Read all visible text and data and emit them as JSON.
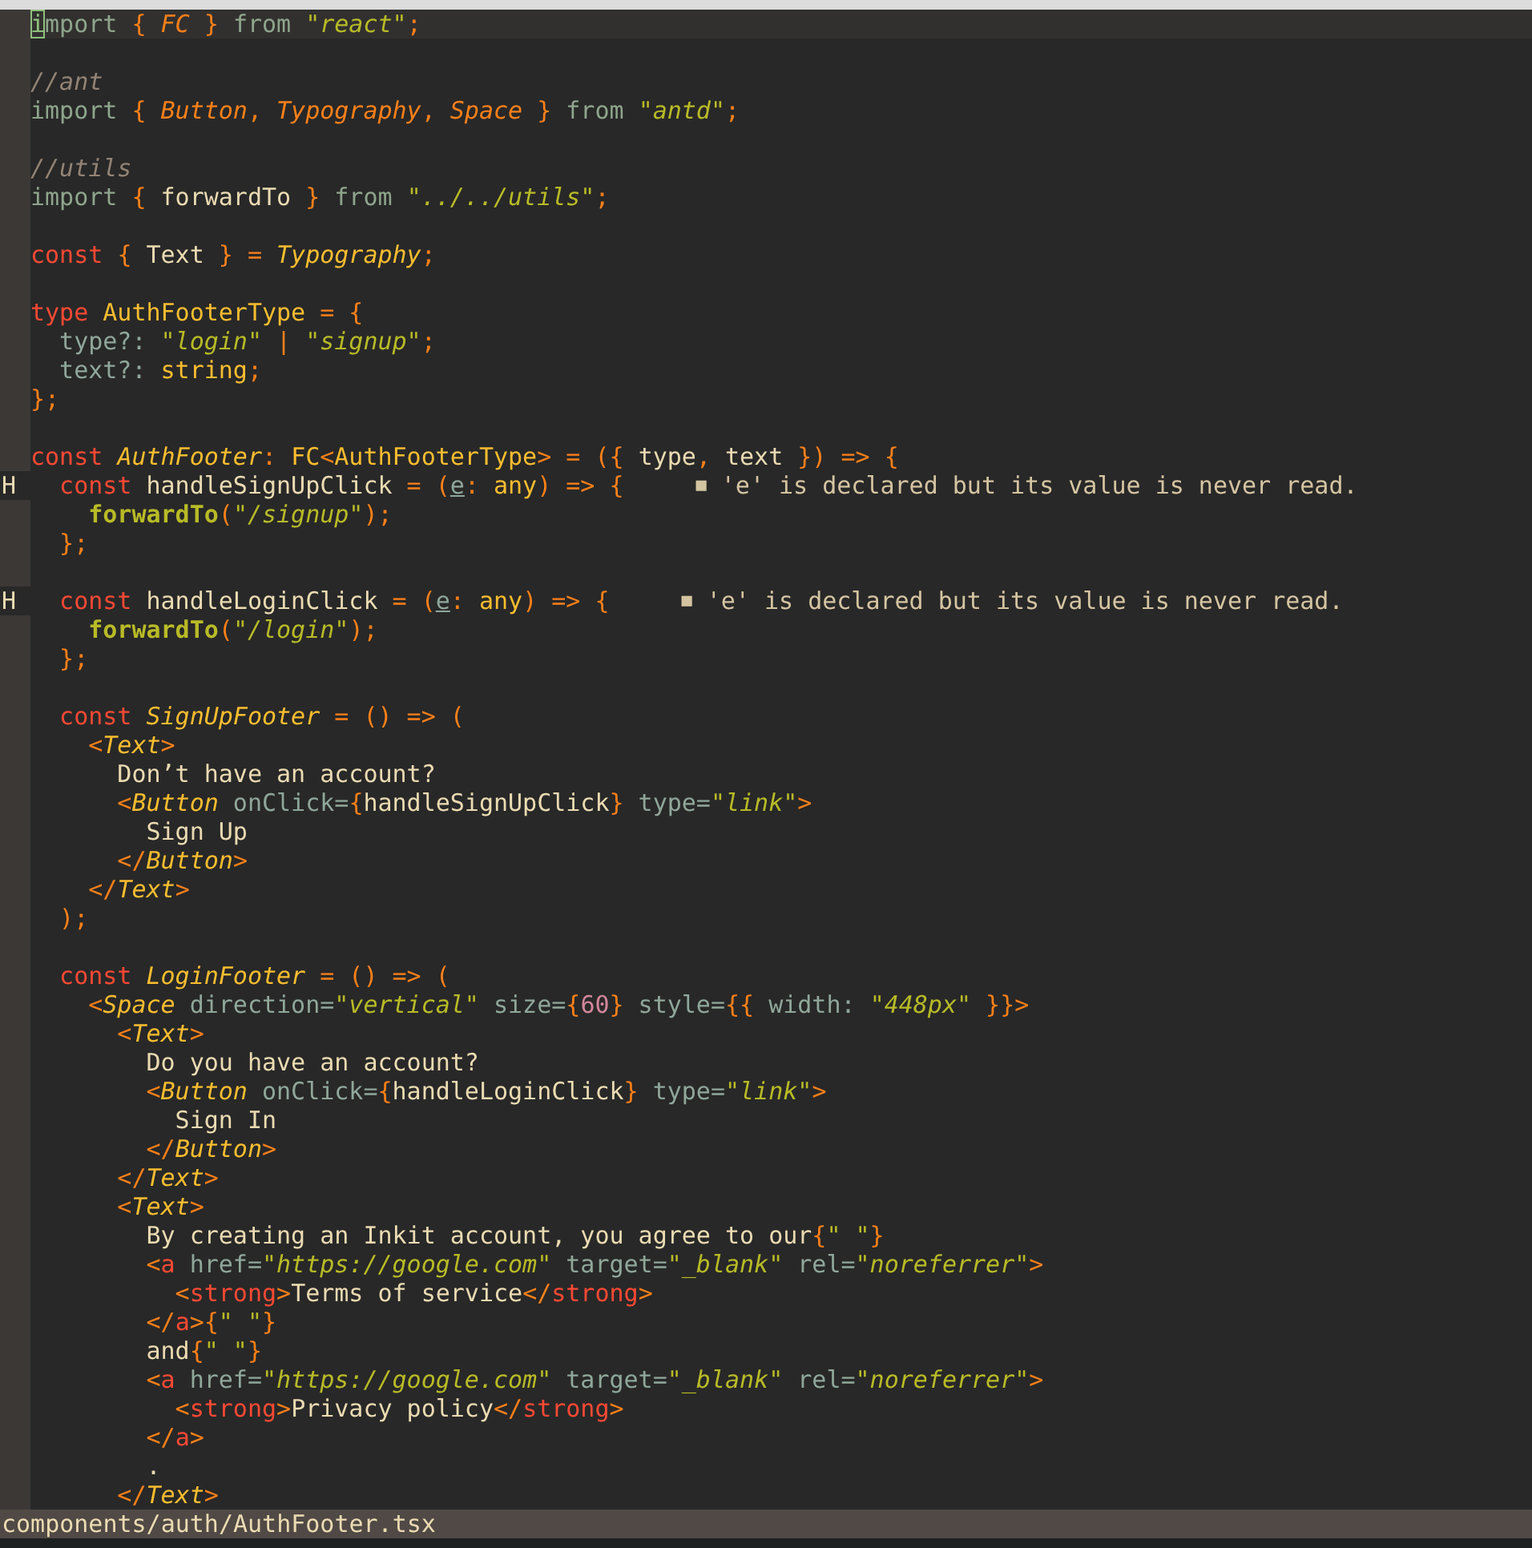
{
  "editor": {
    "lines": [
      {
        "kind": "code",
        "current": true,
        "tokens": [
          {
            "kind": "cur",
            "text": "i"
          },
          {
            "kind": "im",
            "text": "mport "
          },
          {
            "kind": "p",
            "text": "{ "
          },
          {
            "kind": "ti",
            "text": "FC"
          },
          {
            "kind": "p",
            "text": " } "
          },
          {
            "kind": "im",
            "text": "from "
          },
          {
            "kind": "s",
            "text": "\"react\""
          },
          {
            "kind": "p",
            "text": ";"
          }
        ]
      },
      {
        "kind": "blank"
      },
      {
        "kind": "code",
        "tokens": [
          {
            "kind": "c",
            "text": "//ant"
          }
        ]
      },
      {
        "kind": "code",
        "tokens": [
          {
            "kind": "im",
            "text": "import "
          },
          {
            "kind": "p",
            "text": "{ "
          },
          {
            "kind": "ti",
            "text": "Button"
          },
          {
            "kind": "p",
            "text": ", "
          },
          {
            "kind": "ti",
            "text": "Typography"
          },
          {
            "kind": "p",
            "text": ", "
          },
          {
            "kind": "ti",
            "text": "Space"
          },
          {
            "kind": "p",
            "text": " } "
          },
          {
            "kind": "im",
            "text": "from "
          },
          {
            "kind": "s",
            "text": "\"antd\""
          },
          {
            "kind": "p",
            "text": ";"
          }
        ]
      },
      {
        "kind": "blank"
      },
      {
        "kind": "code",
        "tokens": [
          {
            "kind": "c",
            "text": "//utils"
          }
        ]
      },
      {
        "kind": "code",
        "tokens": [
          {
            "kind": "im",
            "text": "import "
          },
          {
            "kind": "p",
            "text": "{ "
          },
          {
            "kind": "id",
            "text": "forwardTo"
          },
          {
            "kind": "p",
            "text": " } "
          },
          {
            "kind": "im",
            "text": "from "
          },
          {
            "kind": "s",
            "text": "\"../../utils\""
          },
          {
            "kind": "p",
            "text": ";"
          }
        ]
      },
      {
        "kind": "blank"
      },
      {
        "kind": "code",
        "tokens": [
          {
            "kind": "kw",
            "text": "const "
          },
          {
            "kind": "p",
            "text": "{ "
          },
          {
            "kind": "id",
            "text": "Text"
          },
          {
            "kind": "p",
            "text": " } = "
          },
          {
            "kind": "ty",
            "text": "Typography"
          },
          {
            "kind": "p",
            "text": ";"
          }
        ]
      },
      {
        "kind": "blank"
      },
      {
        "kind": "code",
        "tokens": [
          {
            "kind": "kw",
            "text": "type "
          },
          {
            "kind": "tn",
            "text": "AuthFooterType"
          },
          {
            "kind": "p",
            "text": " = {"
          }
        ]
      },
      {
        "kind": "code",
        "tokens": [
          {
            "kind": "at",
            "text": "  type?: "
          },
          {
            "kind": "s",
            "text": "\"login\""
          },
          {
            "kind": "p",
            "text": " | "
          },
          {
            "kind": "s",
            "text": "\"signup\""
          },
          {
            "kind": "p",
            "text": ";"
          }
        ]
      },
      {
        "kind": "code",
        "tokens": [
          {
            "kind": "at",
            "text": "  text?: "
          },
          {
            "kind": "tn",
            "text": "string"
          },
          {
            "kind": "p",
            "text": ";"
          }
        ]
      },
      {
        "kind": "code",
        "tokens": [
          {
            "kind": "p",
            "text": "};"
          }
        ]
      },
      {
        "kind": "blank"
      },
      {
        "kind": "code",
        "tokens": [
          {
            "kind": "kw",
            "text": "const "
          },
          {
            "kind": "ty",
            "text": "AuthFooter"
          },
          {
            "kind": "p",
            "text": ": "
          },
          {
            "kind": "tn",
            "text": "FC"
          },
          {
            "kind": "p",
            "text": "<"
          },
          {
            "kind": "tn",
            "text": "AuthFooterType"
          },
          {
            "kind": "p",
            "text": "> = ({ "
          },
          {
            "kind": "id",
            "text": "type"
          },
          {
            "kind": "p",
            "text": ", "
          },
          {
            "kind": "id",
            "text": "text"
          },
          {
            "kind": "p",
            "text": " }) => {"
          }
        ]
      },
      {
        "kind": "code",
        "sign": "H",
        "tokens": [
          {
            "kind": "kw",
            "text": "  const "
          },
          {
            "kind": "id",
            "text": "handleSignUpClick"
          },
          {
            "kind": "p",
            "text": " = ("
          },
          {
            "kind": "u",
            "text": "e"
          },
          {
            "kind": "p",
            "text": ": "
          },
          {
            "kind": "tn",
            "text": "any"
          },
          {
            "kind": "p",
            "text": ") => {"
          }
        ],
        "diagnostic": {
          "marker": "■",
          "text": "'e' is declared but its value is never read."
        }
      },
      {
        "kind": "code",
        "tokens": [
          {
            "kind": "fn",
            "text": "    forwardTo"
          },
          {
            "kind": "p",
            "text": "("
          },
          {
            "kind": "s",
            "text": "\"/signup\""
          },
          {
            "kind": "p",
            "text": ");"
          }
        ]
      },
      {
        "kind": "code",
        "tokens": [
          {
            "kind": "p",
            "text": "  };"
          }
        ]
      },
      {
        "kind": "blank"
      },
      {
        "kind": "code",
        "sign": "H",
        "tokens": [
          {
            "kind": "kw",
            "text": "  const "
          },
          {
            "kind": "id",
            "text": "handleLoginClick"
          },
          {
            "kind": "p",
            "text": " = ("
          },
          {
            "kind": "u",
            "text": "e"
          },
          {
            "kind": "p",
            "text": ": "
          },
          {
            "kind": "tn",
            "text": "any"
          },
          {
            "kind": "p",
            "text": ") => {"
          }
        ],
        "diagnostic": {
          "marker": "■",
          "text": "'e' is declared but its value is never read."
        }
      },
      {
        "kind": "code",
        "tokens": [
          {
            "kind": "fn",
            "text": "    forwardTo"
          },
          {
            "kind": "p",
            "text": "("
          },
          {
            "kind": "s",
            "text": "\"/login\""
          },
          {
            "kind": "p",
            "text": ");"
          }
        ]
      },
      {
        "kind": "code",
        "tokens": [
          {
            "kind": "p",
            "text": "  };"
          }
        ]
      },
      {
        "kind": "blank"
      },
      {
        "kind": "code",
        "tokens": [
          {
            "kind": "kw",
            "text": "  const "
          },
          {
            "kind": "ty",
            "text": "SignUpFooter"
          },
          {
            "kind": "p",
            "text": " = () => ("
          }
        ]
      },
      {
        "kind": "code",
        "tokens": [
          {
            "kind": "p",
            "text": "    <"
          },
          {
            "kind": "ty",
            "text": "Text"
          },
          {
            "kind": "p",
            "text": ">"
          }
        ]
      },
      {
        "kind": "code",
        "tokens": [
          {
            "kind": "id",
            "text": "      Don’t have an account?"
          }
        ]
      },
      {
        "kind": "code",
        "tokens": [
          {
            "kind": "p",
            "text": "      <"
          },
          {
            "kind": "ty",
            "text": "Button"
          },
          {
            "kind": "at",
            "text": " onClick="
          },
          {
            "kind": "p",
            "text": "{"
          },
          {
            "kind": "id",
            "text": "handleSignUpClick"
          },
          {
            "kind": "p",
            "text": "}"
          },
          {
            "kind": "at",
            "text": " type="
          },
          {
            "kind": "s",
            "text": "\"link\""
          },
          {
            "kind": "p",
            "text": ">"
          }
        ]
      },
      {
        "kind": "code",
        "tokens": [
          {
            "kind": "id",
            "text": "        Sign Up"
          }
        ]
      },
      {
        "kind": "code",
        "tokens": [
          {
            "kind": "p",
            "text": "      </"
          },
          {
            "kind": "ty",
            "text": "Button"
          },
          {
            "kind": "p",
            "text": ">"
          }
        ]
      },
      {
        "kind": "code",
        "tokens": [
          {
            "kind": "p",
            "text": "    </"
          },
          {
            "kind": "ty",
            "text": "Text"
          },
          {
            "kind": "p",
            "text": ">"
          }
        ]
      },
      {
        "kind": "code",
        "tokens": [
          {
            "kind": "p",
            "text": "  );"
          }
        ]
      },
      {
        "kind": "blank"
      },
      {
        "kind": "code",
        "tokens": [
          {
            "kind": "kw",
            "text": "  const "
          },
          {
            "kind": "ty",
            "text": "LoginFooter"
          },
          {
            "kind": "p",
            "text": " = () => ("
          }
        ]
      },
      {
        "kind": "code",
        "tokens": [
          {
            "kind": "p",
            "text": "    <"
          },
          {
            "kind": "ty",
            "text": "Space"
          },
          {
            "kind": "at",
            "text": " direction="
          },
          {
            "kind": "s",
            "text": "\"vertical\""
          },
          {
            "kind": "at",
            "text": " size="
          },
          {
            "kind": "p",
            "text": "{"
          },
          {
            "kind": "num",
            "text": "60"
          },
          {
            "kind": "p",
            "text": "}"
          },
          {
            "kind": "at",
            "text": " style="
          },
          {
            "kind": "p",
            "text": "{{ "
          },
          {
            "kind": "at",
            "text": "width: "
          },
          {
            "kind": "s",
            "text": "\"448px\""
          },
          {
            "kind": "p",
            "text": " }}>"
          }
        ]
      },
      {
        "kind": "code",
        "tokens": [
          {
            "kind": "p",
            "text": "      <"
          },
          {
            "kind": "ty",
            "text": "Text"
          },
          {
            "kind": "p",
            "text": ">"
          }
        ]
      },
      {
        "kind": "code",
        "tokens": [
          {
            "kind": "id",
            "text": "        Do you have an account?"
          }
        ]
      },
      {
        "kind": "code",
        "tokens": [
          {
            "kind": "p",
            "text": "        <"
          },
          {
            "kind": "ty",
            "text": "Button"
          },
          {
            "kind": "at",
            "text": " onClick="
          },
          {
            "kind": "p",
            "text": "{"
          },
          {
            "kind": "id",
            "text": "handleLoginClick"
          },
          {
            "kind": "p",
            "text": "}"
          },
          {
            "kind": "at",
            "text": " type="
          },
          {
            "kind": "s",
            "text": "\"link\""
          },
          {
            "kind": "p",
            "text": ">"
          }
        ]
      },
      {
        "kind": "code",
        "tokens": [
          {
            "kind": "id",
            "text": "          Sign In"
          }
        ]
      },
      {
        "kind": "code",
        "tokens": [
          {
            "kind": "p",
            "text": "        </"
          },
          {
            "kind": "ty",
            "text": "Button"
          },
          {
            "kind": "p",
            "text": ">"
          }
        ]
      },
      {
        "kind": "code",
        "tokens": [
          {
            "kind": "p",
            "text": "      </"
          },
          {
            "kind": "ty",
            "text": "Text"
          },
          {
            "kind": "p",
            "text": ">"
          }
        ]
      },
      {
        "kind": "code",
        "tokens": [
          {
            "kind": "p",
            "text": "      <"
          },
          {
            "kind": "ty",
            "text": "Text"
          },
          {
            "kind": "p",
            "text": ">"
          }
        ]
      },
      {
        "kind": "code",
        "tokens": [
          {
            "kind": "id",
            "text": "        By creating an Inkit account, you agree to our"
          },
          {
            "kind": "p",
            "text": "{"
          },
          {
            "kind": "s",
            "text": "\" \""
          },
          {
            "kind": "p",
            "text": "}"
          }
        ]
      },
      {
        "kind": "code",
        "tokens": [
          {
            "kind": "p",
            "text": "        <"
          },
          {
            "kind": "tag",
            "text": "a"
          },
          {
            "kind": "at",
            "text": " href="
          },
          {
            "kind": "s",
            "text": "\"https://google.com\""
          },
          {
            "kind": "at",
            "text": " target="
          },
          {
            "kind": "s",
            "text": "\"_blank\""
          },
          {
            "kind": "at",
            "text": " rel="
          },
          {
            "kind": "s",
            "text": "\"noreferrer\""
          },
          {
            "kind": "p",
            "text": ">"
          }
        ]
      },
      {
        "kind": "code",
        "tokens": [
          {
            "kind": "p",
            "text": "          <"
          },
          {
            "kind": "tag",
            "text": "strong"
          },
          {
            "kind": "p",
            "text": ">"
          },
          {
            "kind": "id",
            "text": "Terms of service"
          },
          {
            "kind": "p",
            "text": "</"
          },
          {
            "kind": "tag",
            "text": "strong"
          },
          {
            "kind": "p",
            "text": ">"
          }
        ]
      },
      {
        "kind": "code",
        "tokens": [
          {
            "kind": "p",
            "text": "        </"
          },
          {
            "kind": "tag",
            "text": "a"
          },
          {
            "kind": "p",
            "text": ">{"
          },
          {
            "kind": "s",
            "text": "\" \""
          },
          {
            "kind": "p",
            "text": "}"
          }
        ]
      },
      {
        "kind": "code",
        "tokens": [
          {
            "kind": "id",
            "text": "        and"
          },
          {
            "kind": "p",
            "text": "{"
          },
          {
            "kind": "s",
            "text": "\" \""
          },
          {
            "kind": "p",
            "text": "}"
          }
        ]
      },
      {
        "kind": "code",
        "tokens": [
          {
            "kind": "p",
            "text": "        <"
          },
          {
            "kind": "tag",
            "text": "a"
          },
          {
            "kind": "at",
            "text": " href="
          },
          {
            "kind": "s",
            "text": "\"https://google.com\""
          },
          {
            "kind": "at",
            "text": " target="
          },
          {
            "kind": "s",
            "text": "\"_blank\""
          },
          {
            "kind": "at",
            "text": " rel="
          },
          {
            "kind": "s",
            "text": "\"noreferrer\""
          },
          {
            "kind": "p",
            "text": ">"
          }
        ]
      },
      {
        "kind": "code",
        "tokens": [
          {
            "kind": "p",
            "text": "          <"
          },
          {
            "kind": "tag",
            "text": "strong"
          },
          {
            "kind": "p",
            "text": ">"
          },
          {
            "kind": "id",
            "text": "Privacy policy"
          },
          {
            "kind": "p",
            "text": "</"
          },
          {
            "kind": "tag",
            "text": "strong"
          },
          {
            "kind": "p",
            "text": ">"
          }
        ]
      },
      {
        "kind": "code",
        "tokens": [
          {
            "kind": "p",
            "text": "        </"
          },
          {
            "kind": "tag",
            "text": "a"
          },
          {
            "kind": "p",
            "text": ">"
          }
        ]
      },
      {
        "kind": "code",
        "tokens": [
          {
            "kind": "id",
            "text": "        ."
          }
        ]
      },
      {
        "kind": "code",
        "tokens": [
          {
            "kind": "p",
            "text": "      </"
          },
          {
            "kind": "ty",
            "text": "Text"
          },
          {
            "kind": "p",
            "text": ">"
          }
        ]
      }
    ]
  },
  "status_bar": {
    "file_path": "components/auth/AuthFooter.tsx"
  }
}
